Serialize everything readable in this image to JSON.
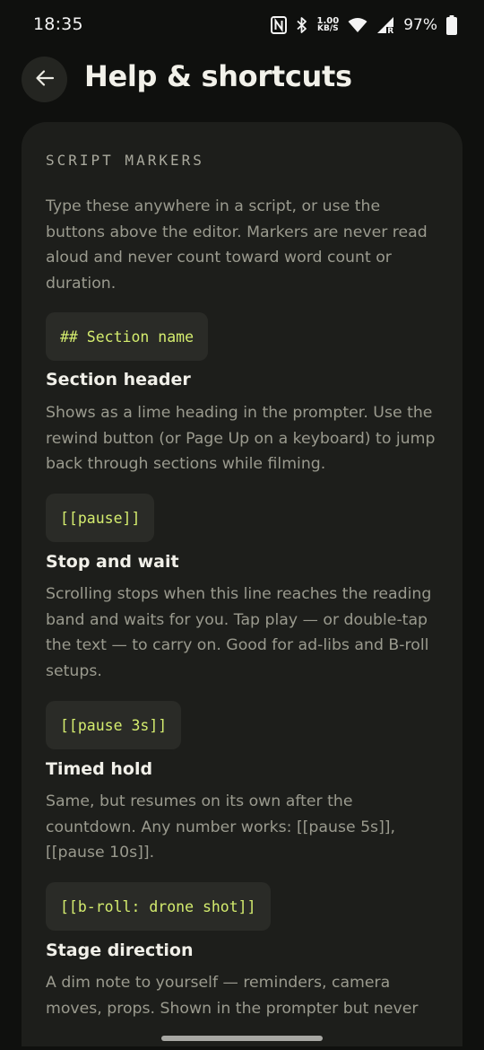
{
  "status_bar": {
    "time": "18:35",
    "net_speed_value": "1.00",
    "net_speed_unit": "KB/S",
    "signal_label": "R",
    "battery": "97%",
    "icons": [
      "nfc-icon",
      "bluetooth-icon",
      "wifi-icon",
      "signal-icon",
      "battery-icon"
    ]
  },
  "header": {
    "title": "Help & shortcuts",
    "back_icon": "arrow-left-icon"
  },
  "card": {
    "section_label": "SCRIPT MARKERS",
    "intro": "Type these anywhere in a script, or use the buttons above the editor. Markers are never read aloud and never count toward word count or duration.",
    "markers": [
      {
        "code": "## Section name",
        "title": "Section header",
        "description": "Shows as a lime heading in the prompter. Use the rewind button (or Page Up on a keyboard) to jump back through sections while filming."
      },
      {
        "code": "[[pause]]",
        "title": "Stop and wait",
        "description": "Scrolling stops when this line reaches the reading band and waits for you. Tap play — or double-tap the text — to carry on. Good for ad-libs and B-roll setups."
      },
      {
        "code": "[[pause 3s]]",
        "title": "Timed hold",
        "description": "Same, but resumes on its own after the countdown. Any number works: [[pause 5s]], [[pause 10s]]."
      },
      {
        "code": "[[b-roll: drone shot]]",
        "title": "Stage direction",
        "description": "A dim note to yourself — reminders, camera moves, props. Shown in the prompter but never"
      }
    ]
  },
  "colors": {
    "background": "#0f100e",
    "card": "#1d1e1b",
    "chip": "#2a2b27",
    "accent_lime": "#d4ec6e",
    "body_text": "#9a9a8e",
    "title_text": "#f2f1ea"
  }
}
